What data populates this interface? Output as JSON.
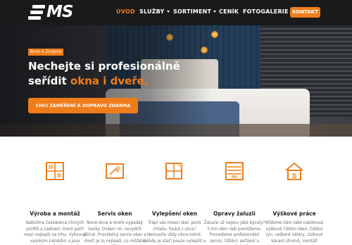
{
  "brand": {
    "logo_text": "MS",
    "accent": "#f07d1c",
    "header_bg": "#181a1c"
  },
  "nav": {
    "items": [
      {
        "label": "ÚVOD",
        "active": true
      },
      {
        "label": "SLUŽBY",
        "dropdown": true
      },
      {
        "label": "SORTIMENT",
        "dropdown": true
      },
      {
        "label": "CENÍK"
      },
      {
        "label": "FOTOGALERIE"
      }
    ],
    "cta": "KONTAKT"
  },
  "hero": {
    "tag": "Brno a Znojmo",
    "headline_line1": "Nechejte si profesionálně",
    "headline_line2_prefix": "seřídit ",
    "headline_line2_accent": "okna i dveře.",
    "cta": "CHCI ZAMĚŘENÍ A DOPRAVU ZDARMA"
  },
  "services": [
    {
      "icon": "window-frame-icon",
      "title": "Výroba a montáž",
      "text": "Nabízíme českáokna různých profilů a zasklení, které patří mezi nejlepší na trhu. Vyhovují vysokým nárokům a jsou vhodná pro všechny stavby."
    },
    {
      "icon": "window-repair-icon",
      "title": "Servis oken",
      "text": "Nová okna a dveře vypadají hezky. Ovšem nic nevydrží věčně. Pravidelný servis oken a dveří je to nejlepší, co můžete udělat."
    },
    {
      "icon": "window-sparkle-icon",
      "title": "Vylepšení oken",
      "text": "Trápí vás rosení skel, pocit chladu, fouká z ulice? Nemusíte vždy okna měnit. Někdy je stačí pouze vylepšit a od toho jsme tu my."
    },
    {
      "icon": "blinds-repair-icon",
      "title": "Opravy žaluzií",
      "text": "Žaluzie už nejsou jaké bývaly? S tím Vám rádi pomůžeme. Provedeme profesionální servis, čištění, seřízení a opravy žaluzií."
    },
    {
      "icon": "house-work-icon",
      "title": "Výškové práce",
      "text": "Můžeme Vám také nabídnout výškové čištění oken, čištění rýn, veškeré nátěry, rizikové kácení stromů, montáž banneru a mnohem více."
    }
  ]
}
